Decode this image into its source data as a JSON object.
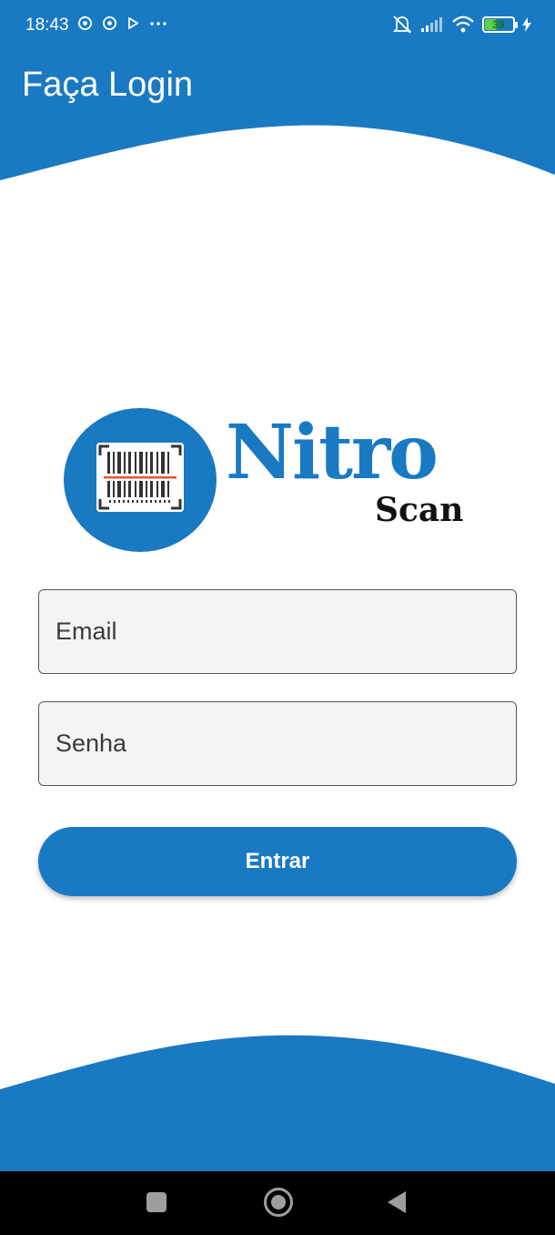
{
  "colors": {
    "primary": "#1a79c3",
    "background": "#ffffff",
    "field_bg": "#f4f4f4",
    "nav_bar": "#000000"
  },
  "status_bar": {
    "time": "18:43",
    "battery": "39",
    "icons_left": [
      "chrome-icon",
      "chrome-icon",
      "play-icon",
      "more-dots-icon"
    ],
    "icons_right": [
      "mute-vibrate-icon",
      "signal-icon",
      "wifi-icon",
      "battery-icon",
      "charging-icon"
    ]
  },
  "header": {
    "title": "Faça Login"
  },
  "logo": {
    "line1": "Nitro",
    "line2": "Scan",
    "icon": "barcode-scanner-icon"
  },
  "form": {
    "email_placeholder": "Email",
    "password_placeholder": "Senha",
    "submit_label": "Entrar"
  },
  "nav_bar": {
    "buttons": [
      "recent-apps",
      "home",
      "back"
    ]
  }
}
